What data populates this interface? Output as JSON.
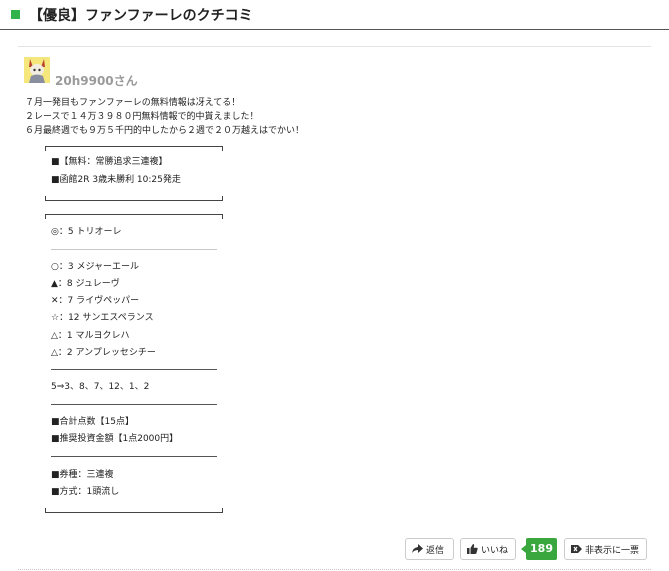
{
  "header": {
    "title": "【優良】ファンファーレのクチコミ"
  },
  "post": {
    "username": "20h9900さん",
    "intro": [
      "７月一発目もファンファーレの無料情報は冴えてる！",
      "２レースで１４万３９８０円無料情報で的中貰えました！",
      "６月最終週でも９万５千円的中したから２週で２０万越えはでかい！"
    ],
    "race": {
      "line1": "■【無料：常勝追求三連複】",
      "line2": "■函館2R 3歳未勝利 10:25発走"
    },
    "picks": {
      "main": "◎：5 トリオーレ",
      "others": [
        "○：3 メジャーエール",
        "▲：8 ジュレーヴ",
        "✕：7 ライヴペッパー",
        "☆：12 サンエスペランス",
        "△：1 マルヨクレハ",
        "△：2 アンプレッセシチー"
      ],
      "formation": "5⇒3、8、7、12、1、2",
      "points": "■合計点数【15点】",
      "stake": "■推奨投資金額【1点2000円】",
      "ticket_type": "■券種：三連複",
      "method": "■方式：1頭流し"
    }
  },
  "actions": {
    "reply_label": "返信",
    "like_label": "いいね",
    "like_count": "189",
    "hide_label": "非表示に一票"
  },
  "colors": {
    "accent_green": "#3aa63e",
    "header_square": "#2fb34a"
  }
}
